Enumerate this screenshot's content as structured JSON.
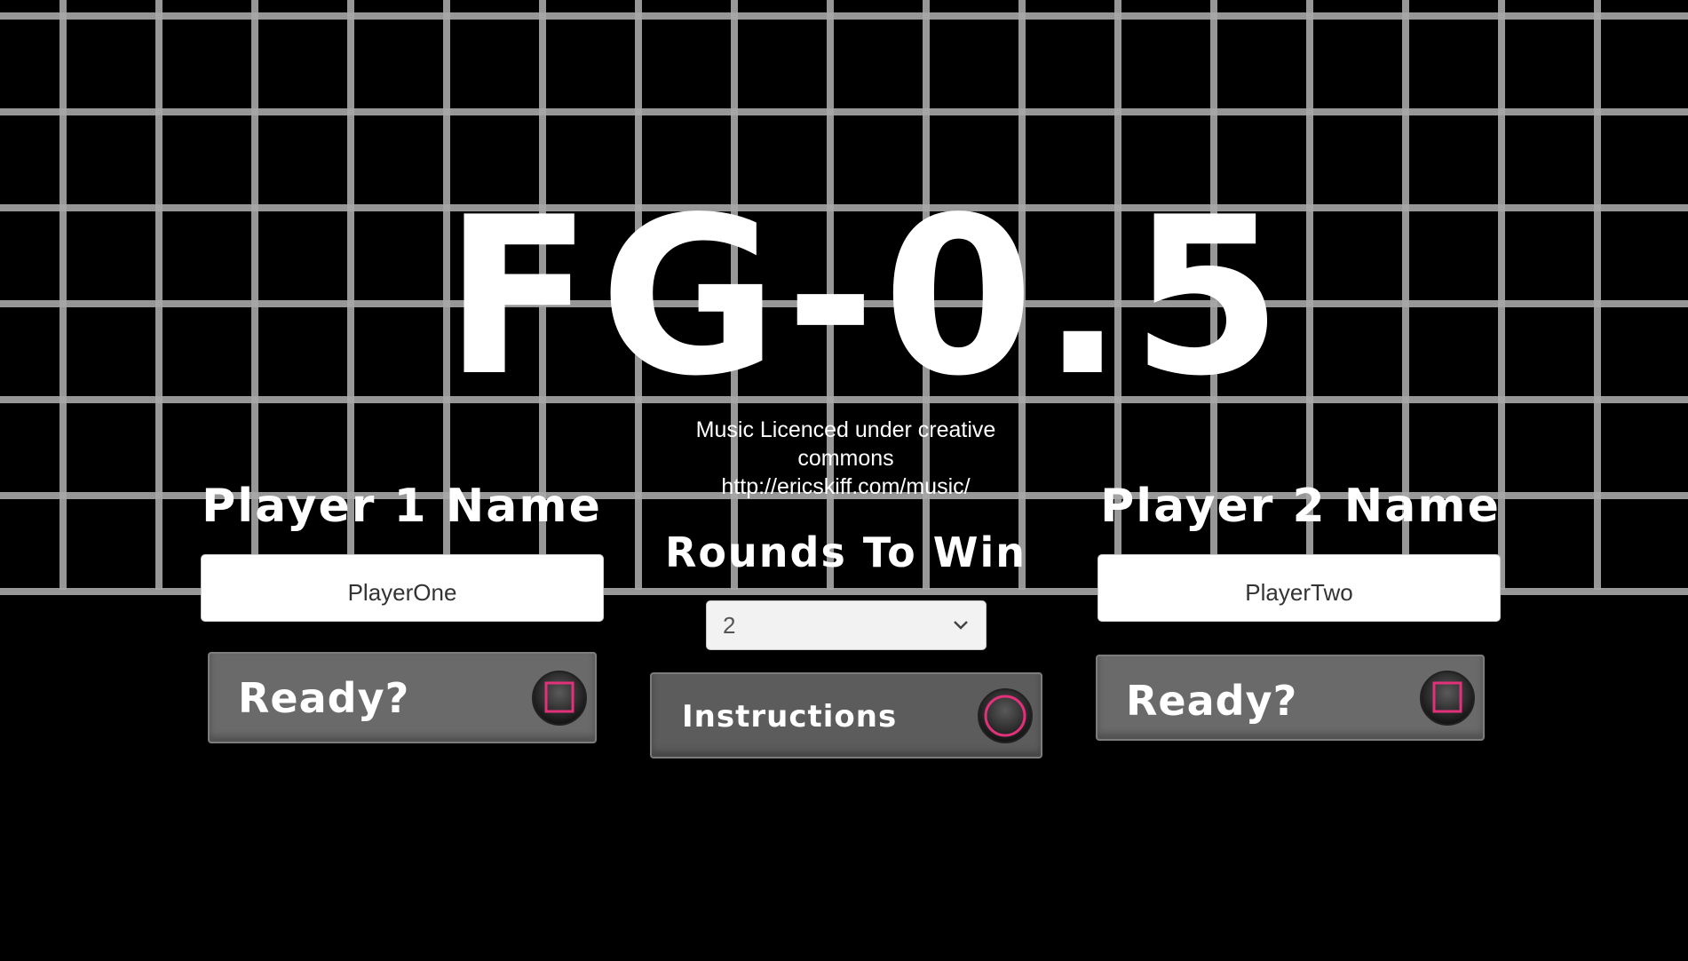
{
  "game": {
    "title": "FG-0.5",
    "credit_line1": "Music Licenced under creative",
    "credit_line2": "commons",
    "credit_line3": "http://ericskiff.com/music/"
  },
  "player1": {
    "heading": "Player 1 Name",
    "name_value": "PlayerOne",
    "ready_label": "Ready?",
    "ready_icon": "square-button-icon"
  },
  "player2": {
    "heading": "Player 2 Name",
    "name_value": "PlayerTwo",
    "ready_label": "Ready?",
    "ready_icon": "square-button-icon"
  },
  "rounds": {
    "heading": "Rounds To Win",
    "selected": "2",
    "dropdown_icon": "chevron-down-icon"
  },
  "instructions": {
    "label": "Instructions",
    "icon": "circle-button-icon"
  },
  "colors": {
    "background": "#000000",
    "grid_line": "#a8a8a8",
    "accent_pink": "#e0317a",
    "button_panel": "#6a6a6a"
  }
}
